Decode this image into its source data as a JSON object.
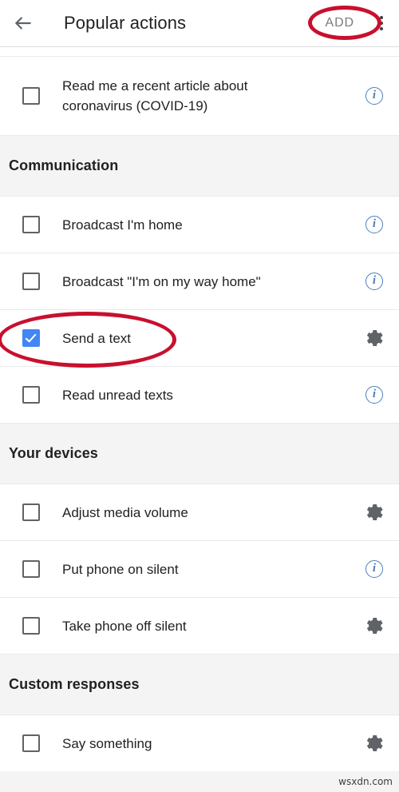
{
  "appbar": {
    "back_icon": "back-arrow-icon",
    "title": "Popular actions",
    "add_label": "ADD",
    "overflow_icon": "more-vertical-icon"
  },
  "colors": {
    "accent_checkbox": "#4285f4",
    "info_icon": "#4a7ebb",
    "gear_icon": "#5f6368",
    "section_bg": "#f4f4f4",
    "annotation_red": "#c8102e",
    "divider": "#dadce0"
  },
  "list": [
    {
      "type": "item",
      "label": "Read me a recent article about\ncoronavirus (COVID-19)",
      "checked": false,
      "trailing": "info-icon",
      "tall": true
    },
    {
      "type": "section",
      "label": "Communication"
    },
    {
      "type": "item",
      "label": "Broadcast I'm home",
      "checked": false,
      "trailing": "info-icon",
      "tall": false
    },
    {
      "type": "item",
      "label": "Broadcast \"I'm on my way home\"",
      "checked": false,
      "trailing": "info-icon",
      "tall": false
    },
    {
      "type": "item",
      "label": "Send a text",
      "checked": true,
      "trailing": "gear-icon",
      "tall": false
    },
    {
      "type": "item",
      "label": "Read unread texts",
      "checked": false,
      "trailing": "info-icon",
      "tall": false
    },
    {
      "type": "section",
      "label": "Your devices"
    },
    {
      "type": "item",
      "label": "Adjust media volume",
      "checked": false,
      "trailing": "gear-icon",
      "tall": false
    },
    {
      "type": "item",
      "label": "Put phone on silent",
      "checked": false,
      "trailing": "info-icon",
      "tall": false
    },
    {
      "type": "item",
      "label": "Take phone off silent",
      "checked": false,
      "trailing": "gear-icon",
      "tall": false
    },
    {
      "type": "section",
      "label": "Custom responses"
    },
    {
      "type": "item",
      "label": "Say something",
      "checked": false,
      "trailing": "gear-icon",
      "tall": false
    }
  ],
  "annotations": [
    {
      "name": "add-button-highlight",
      "target": "ADD"
    },
    {
      "name": "send-a-text-highlight",
      "target": "Send a text"
    }
  ],
  "footer": {
    "watermark": "wsxdn.com"
  }
}
